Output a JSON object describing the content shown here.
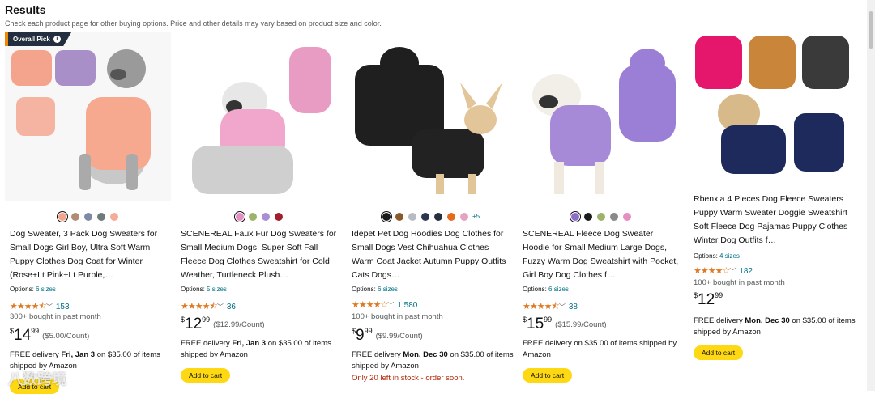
{
  "results": {
    "title": "Results",
    "subtitle": "Check each product page for other buying options. Price and other details may vary based on product size and color."
  },
  "badge": {
    "label": "Overall Pick",
    "info_icon": "info-icon"
  },
  "cart_label": "Add to cart",
  "watermark": "八数跨境",
  "products": [
    {
      "colors": [
        "#f4a38c",
        "#b38b75",
        "#7d8aa6",
        "#6f7b7a",
        "#f5ab98"
      ],
      "title": "Dog Sweater, 3 Pack Dog Sweaters for Small Dogs Girl Boy, Ultra Soft Warm Puppy Clothes Dog Coat for Winter (Rose+Lt Pink+Lt Purple,…",
      "options_label": "Options:",
      "options_value": "6 sizes",
      "stars_text": "★★★★⯪",
      "rating_count": "153",
      "bought": "300+ bought in past month",
      "price_currency": "$",
      "price_whole": "14",
      "price_fraction": "99",
      "unit_price": "($5.00/Count)",
      "delivery_prefix": "FREE delivery ",
      "delivery_date": "Fri, Jan 3",
      "delivery_suffix": " on $35.00 of items shipped by Amazon",
      "stock": ""
    },
    {
      "colors": [
        "#e58fc0",
        "#9db36b",
        "#a88fd4",
        "#a31e2c"
      ],
      "title": "SCENEREAL Faux Fur Dog Sweaters for Small Medium Dogs, Super Soft Fall Fleece Dog Clothes Sweatshirt for Cold Weather, Turtleneck Plush…",
      "options_label": "Options:",
      "options_value": "5 sizes",
      "stars_text": "★★★★⯪",
      "rating_count": "36",
      "bought": "",
      "price_currency": "$",
      "price_whole": "12",
      "price_fraction": "99",
      "unit_price": "($12.99/Count)",
      "delivery_prefix": "FREE delivery ",
      "delivery_date": "Fri, Jan 3",
      "delivery_suffix": " on $35.00 of items shipped by Amazon",
      "stock": ""
    },
    {
      "colors": [
        "#1b1b1b",
        "#8b5a2b",
        "#b8bcc2",
        "#2b3550",
        "#27303f",
        "#e46a1e",
        "#e5a3c4"
      ],
      "more": "+5",
      "title": "Idepet Pet Dog Hoodies Dog Clothes for Small Dogs Vest Chihuahua Clothes Warm Coat Jacket Autumn Puppy Outfits Cats Dogs…",
      "options_label": "Options:",
      "options_value": "6 sizes",
      "stars_text": "★★★★☆",
      "rating_count": "1,580",
      "bought": "100+ bought in past month",
      "price_currency": "$",
      "price_whole": "9",
      "price_fraction": "99",
      "unit_price": "($9.99/Count)",
      "delivery_prefix": "FREE delivery ",
      "delivery_date": "Mon, Dec 30",
      "delivery_suffix": " on $35.00 of items shipped by Amazon",
      "stock": "Only 20 left in stock - order soon."
    },
    {
      "colors": [
        "#8c6cc7",
        "#1b1b1b",
        "#9db36b",
        "#8a8a8a",
        "#e58fc0"
      ],
      "title": "SCENEREAL Fleece Dog Sweater Hoodie for Small Medium Large Dogs, Fuzzy Warm Dog Sweatshirt with Pocket, Girl Boy Dog Clothes f…",
      "options_label": "Options:",
      "options_value": "6 sizes",
      "stars_text": "★★★★⯪",
      "rating_count": "38",
      "bought": "",
      "price_currency": "$",
      "price_whole": "15",
      "price_fraction": "99",
      "unit_price": "($15.99/Count)",
      "delivery_prefix": "FREE delivery on $35.00 of items shipped by Amazon",
      "delivery_date": "",
      "delivery_suffix": "",
      "stock": ""
    },
    {
      "colors": [],
      "title": "Rbenxia 4 Pieces Dog Fleece Sweaters Puppy Warm Sweater Doggie Sweatshirt Soft Fleece Dog Pajamas Puppy Clothes Winter Dog Outfits f…",
      "options_label": "Options:",
      "options_value": "4 sizes",
      "stars_text": "★★★★☆",
      "rating_count": "182",
      "bought": "100+ bought in past month",
      "price_currency": "$",
      "price_whole": "12",
      "price_fraction": "99",
      "unit_price": "",
      "delivery_prefix": "FREE delivery ",
      "delivery_date": "Mon, Dec 30",
      "delivery_suffix": " on $35.00 of items shipped by Amazon",
      "stock": ""
    }
  ]
}
